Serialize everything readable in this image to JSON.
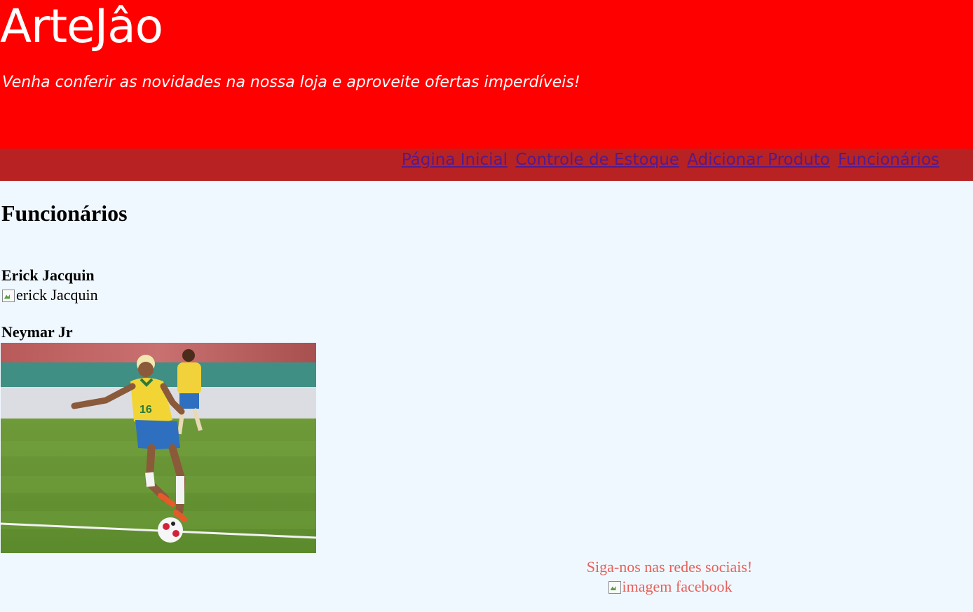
{
  "header": {
    "brand": "ArteJâo",
    "tagline": "Venha conferir as novidades na nossa loja e aproveite ofertas imperdíveis!"
  },
  "nav": {
    "links": [
      "Página Inicial",
      "Controle de Estoque",
      "Adicionar Produto",
      "Funcionários"
    ]
  },
  "main": {
    "title": "Funcionários",
    "employees": [
      {
        "name": "Erick Jacquin",
        "image_alt": "erick Jacquin",
        "image_loaded": false
      },
      {
        "name": "Neymar Jr",
        "image_loaded": true
      }
    ]
  },
  "footer": {
    "text": "Siga-nos nas redes sociais!",
    "facebook_alt": "imagem facebook"
  },
  "colors": {
    "header_bg": "#ff0000",
    "nav_bg": "#b82222",
    "page_bg": "#f0f8ff",
    "link": "#551a8b",
    "footer_text": "#e8605a"
  }
}
